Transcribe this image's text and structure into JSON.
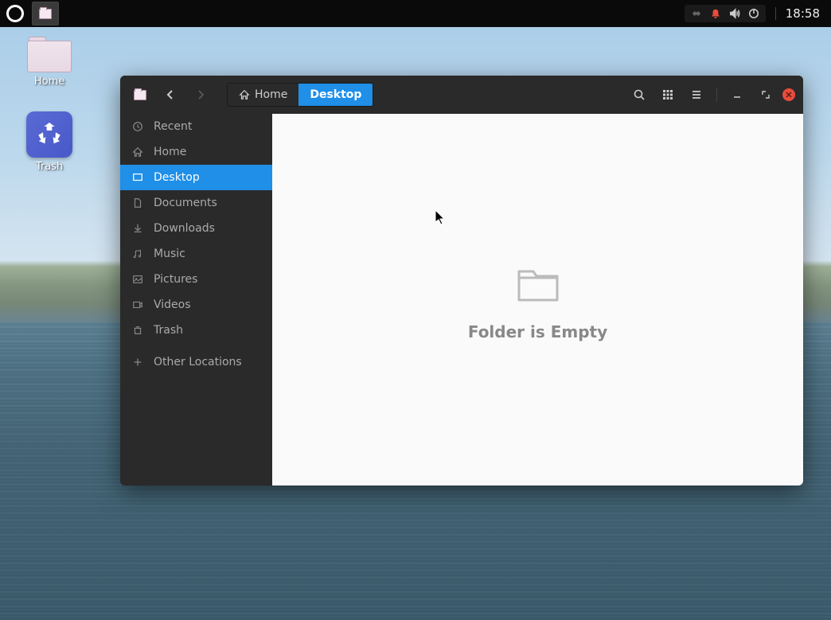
{
  "panel": {
    "clock": "18:58"
  },
  "desktop": {
    "home_label": "Home",
    "trash_label": "Trash"
  },
  "window": {
    "breadcrumb": {
      "home": "Home",
      "current": "Desktop"
    },
    "sidebar": {
      "recent": "Recent",
      "home": "Home",
      "desktop": "Desktop",
      "documents": "Documents",
      "downloads": "Downloads",
      "music": "Music",
      "pictures": "Pictures",
      "videos": "Videos",
      "trash": "Trash",
      "other": "Other Locations"
    },
    "content": {
      "empty_message": "Folder is Empty"
    }
  }
}
